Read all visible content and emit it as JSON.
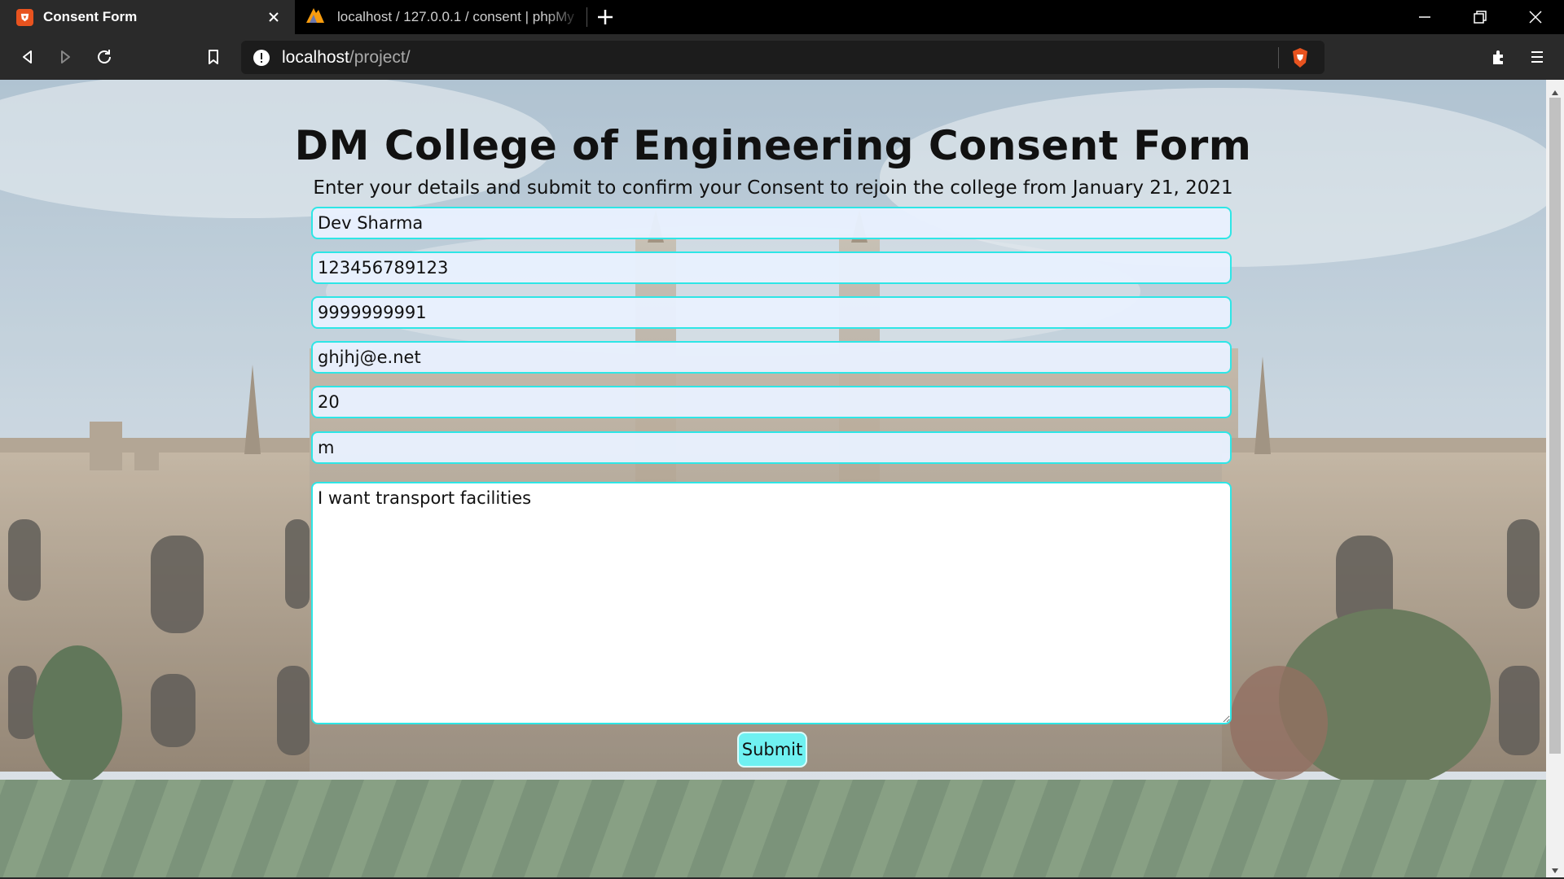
{
  "browser": {
    "tabs": [
      {
        "title": "Consent Form",
        "favicon": "brave-logo-icon",
        "active": true
      },
      {
        "title": "localhost / 127.0.0.1 / consent | phpMy",
        "favicon": "phpmyadmin-icon",
        "active": false
      }
    ],
    "address_bar": {
      "host": "localhost",
      "path": "/project/"
    }
  },
  "page": {
    "title": "DM College of Engineering Consent Form",
    "subtitle": "Enter your details and submit to confirm your Consent to rejoin the college from January 21, 2021",
    "fields": {
      "name": "Dev Sharma",
      "id_number": "123456789123",
      "phone": "9999999991",
      "email": "ghjhj@e.net",
      "age": "20",
      "gender": "m",
      "message": "I want transport facilities"
    },
    "submit_label": "Submit"
  },
  "colors": {
    "field_border": "#2ee6e6",
    "submit_bg": "#6ff1f1",
    "brave_orange": "#e8531f"
  }
}
